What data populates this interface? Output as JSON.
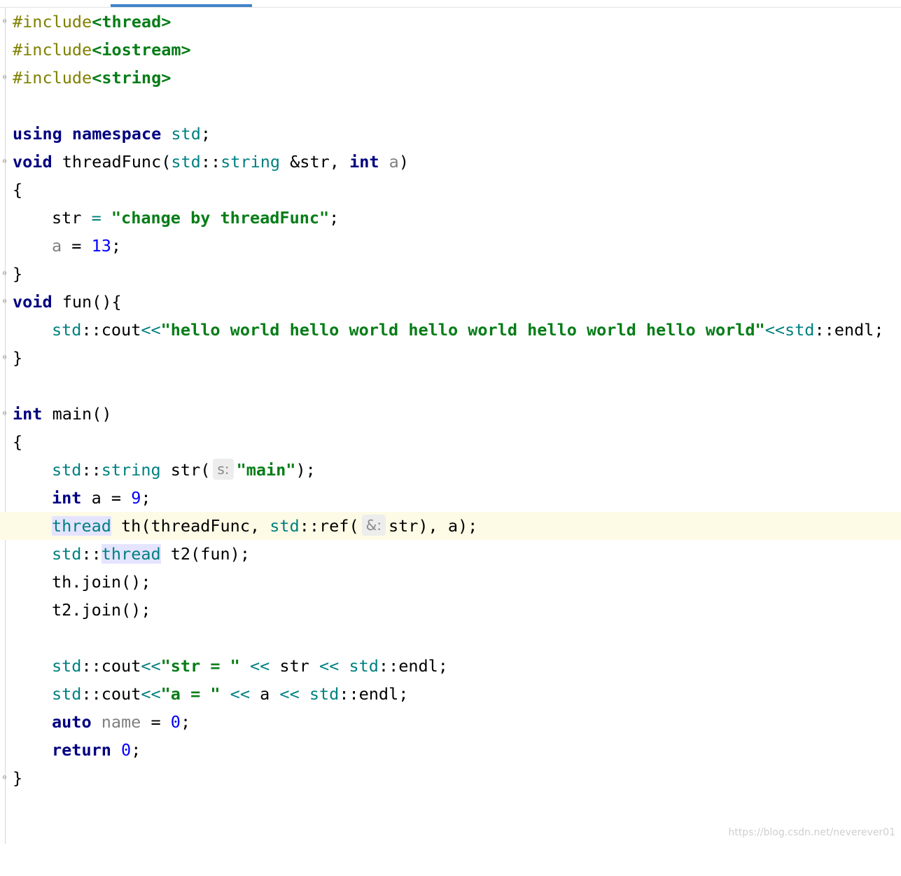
{
  "editor": {
    "lines": {
      "l1": {
        "pp": "#include",
        "inc": "<thread>"
      },
      "l2": {
        "pp": "#include",
        "inc": "<iostream>"
      },
      "l3": {
        "pp": "#include",
        "inc": "<string>"
      },
      "l5": {
        "kw1": "using",
        "kw2": "namespace",
        "ns": "std",
        "end": ";"
      },
      "l6": {
        "kw": "void",
        "name": " threadFunc(",
        "ns1": "std",
        "sep1": "::",
        "type": "string",
        "ref": " &str, ",
        "kw2": "int",
        "par": "a",
        "end": ")"
      },
      "l7": {
        "text": "{"
      },
      "l8": {
        "lhs": "str ",
        "op": "=",
        "str": "\"change by threadFunc\"",
        "end": ";"
      },
      "l9": {
        "par": "a",
        "op": " = ",
        "num": "13",
        "end": ";"
      },
      "l10": {
        "text": "}"
      },
      "l11": {
        "kw": "void",
        "rest": " fun(){"
      },
      "l12": {
        "ns": "std",
        "mid": "::cout",
        "op": "<<",
        "str": "\"hello world hello world hello world hello world hello world\"",
        "op2": "<<",
        "ns2": "std",
        "end": "::endl;"
      },
      "l13": {
        "text": "}"
      },
      "l15": {
        "kw": "int",
        "rest": " main()"
      },
      "l16": {
        "text": "{"
      },
      "l17": {
        "ns": "std",
        "sep": "::",
        "type": "string",
        "call": " str(",
        "hint": "s:",
        "str": "\"main\"",
        "end": ");"
      },
      "l18": {
        "kw": "int",
        "rest": " a = ",
        "num": "9",
        "end": ";"
      },
      "l19": {
        "type": "thread",
        "rest": " th(threadFunc, ",
        "ns": "std",
        "call": "::ref(",
        "hint": "&:",
        "end": "str), a);"
      },
      "l20": {
        "ns": "std",
        "sep": "::",
        "type": "thread",
        "rest": " t2(fun);"
      },
      "l21": {
        "text": "th.join();"
      },
      "l22": {
        "text": "t2.join();"
      },
      "l24": {
        "ns": "std",
        "mid": "::cout",
        "op": "<<",
        "str": "\"str = \"",
        "op2": " << ",
        "var": "str",
        "op3": " << ",
        "ns2": "std",
        "end": "::endl;"
      },
      "l25": {
        "ns": "std",
        "mid": "::cout",
        "op": "<<",
        "str": "\"a = \"",
        "op2": " << ",
        "var": "a",
        "op3": " << ",
        "ns2": "std",
        "end": "::endl;"
      },
      "l26": {
        "kw": "auto",
        "unused": " name",
        "rest": " = ",
        "num": "0",
        "end": ";"
      },
      "l27": {
        "kw": "return",
        "sp": " ",
        "num": "0",
        "end": ";"
      },
      "l28": {
        "text": "}"
      }
    }
  },
  "fold_markers": {
    "open": "⊖",
    "close": "⊖"
  },
  "watermark": "https://blog.csdn.net/neverever01"
}
